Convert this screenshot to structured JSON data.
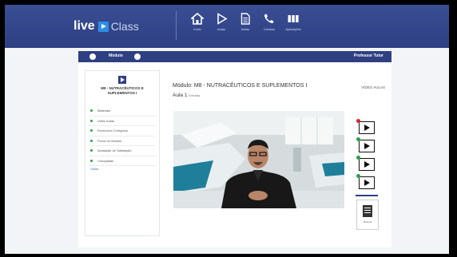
{
  "header": {
    "logo_live": "live",
    "logo_class": "Class",
    "nav": [
      {
        "icon": "home-icon",
        "label": "Início"
      },
      {
        "icon": "play-icon",
        "label": "Aulas"
      },
      {
        "icon": "document-icon",
        "label": "Notas"
      },
      {
        "icon": "phone-icon",
        "label": "Contato"
      },
      {
        "icon": "grid-icon",
        "label": "Aplicações"
      }
    ]
  },
  "subnav": {
    "label": "Módulo",
    "right": "Professor Tutor"
  },
  "sidebar": {
    "title": "M8 - NUTRACÊUTICOS E SUPLEMENTOS I",
    "items": [
      "Materiais",
      "Video Aulas",
      "Exercícios Corrigidos",
      "Prova do Módulo",
      "Avaliação de Satisfação",
      "Conquistas"
    ],
    "back": "Voltar"
  },
  "main": {
    "module_title": "Módulo: M8 - NUTRACÊUTICOS E SUPLEMENTOS I",
    "lesson": "Aula 1",
    "lesson_small": "Entrada",
    "video_link": "VÍDEO AULAS",
    "doc_label": "Material"
  },
  "colors": {
    "primary": "#2e3f82",
    "accent": "#2d8ee6",
    "done": "#2aa14a",
    "current": "#d9262b"
  },
  "rail": {
    "videos": [
      {
        "state": "current"
      },
      {
        "state": "done"
      },
      {
        "state": "done"
      },
      {
        "state": "done"
      }
    ]
  }
}
